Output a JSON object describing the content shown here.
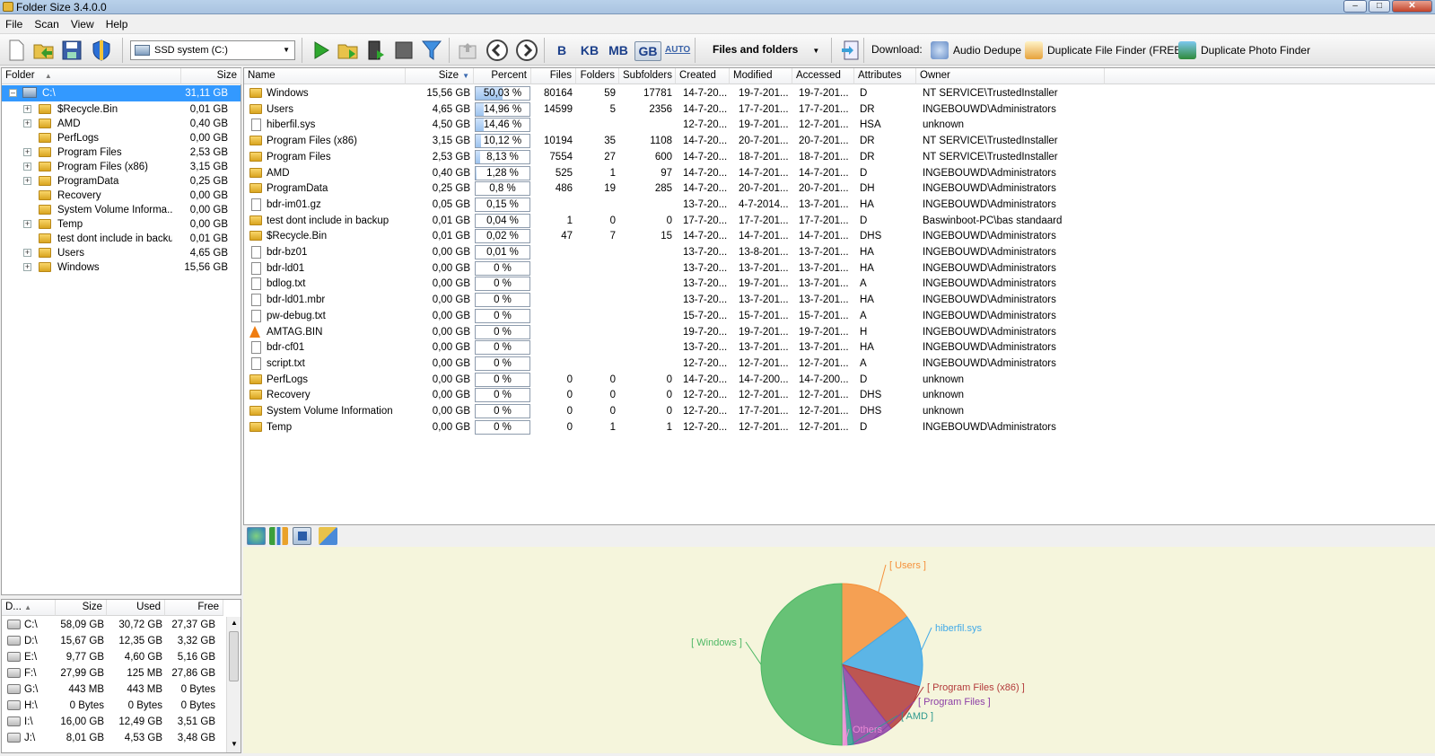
{
  "window": {
    "title": "Folder Size 3.4.0.0"
  },
  "menu": [
    "File",
    "Scan",
    "View",
    "Help"
  ],
  "toolbar": {
    "drive_select": "SSD system (C:)",
    "units": [
      "B",
      "KB",
      "MB",
      "GB",
      "AUTO"
    ],
    "active_unit": "GB",
    "view_mode": "Files and folders",
    "download_label": "Download:",
    "downloads": [
      "Audio Dedupe",
      "Duplicate File Finder (FREE)",
      "Duplicate Photo Finder"
    ]
  },
  "tree": {
    "headers": {
      "folder": "Folder",
      "size": "Size"
    },
    "root": {
      "name": "C:\\",
      "size": "31,11 GB"
    },
    "items": [
      {
        "name": "$Recycle.Bin",
        "size": "0,01 GB",
        "expandable": true
      },
      {
        "name": "AMD",
        "size": "0,40 GB",
        "expandable": true
      },
      {
        "name": "PerfLogs",
        "size": "0,00 GB",
        "expandable": false
      },
      {
        "name": "Program Files",
        "size": "2,53 GB",
        "expandable": true
      },
      {
        "name": "Program Files (x86)",
        "size": "3,15 GB",
        "expandable": true
      },
      {
        "name": "ProgramData",
        "size": "0,25 GB",
        "expandable": true
      },
      {
        "name": "Recovery",
        "size": "0,00 GB",
        "expandable": false
      },
      {
        "name": "System Volume Informa...",
        "size": "0,00 GB",
        "expandable": false
      },
      {
        "name": "Temp",
        "size": "0,00 GB",
        "expandable": true
      },
      {
        "name": "test dont include in backup",
        "size": "0,01 GB",
        "expandable": false
      },
      {
        "name": "Users",
        "size": "4,65 GB",
        "expandable": true
      },
      {
        "name": "Windows",
        "size": "15,56 GB",
        "expandable": true
      }
    ]
  },
  "drives": {
    "headers": {
      "drive": "D...",
      "size": "Size",
      "used": "Used",
      "free": "Free"
    },
    "rows": [
      {
        "drive": "C:\\",
        "size": "58,09 GB",
        "used": "30,72 GB",
        "free": "27,37 GB"
      },
      {
        "drive": "D:\\",
        "size": "15,67 GB",
        "used": "12,35 GB",
        "free": "3,32 GB"
      },
      {
        "drive": "E:\\",
        "size": "9,77 GB",
        "used": "4,60 GB",
        "free": "5,16 GB"
      },
      {
        "drive": "F:\\",
        "size": "27,99 GB",
        "used": "125 MB",
        "free": "27,86 GB"
      },
      {
        "drive": "G:\\",
        "size": "443 MB",
        "used": "443 MB",
        "free": "0 Bytes"
      },
      {
        "drive": "H:\\",
        "size": "0 Bytes",
        "used": "0 Bytes",
        "free": "0 Bytes"
      },
      {
        "drive": "I:\\",
        "size": "16,00 GB",
        "used": "12,49 GB",
        "free": "3,51 GB"
      },
      {
        "drive": "J:\\",
        "size": "8,01 GB",
        "used": "4,53 GB",
        "free": "3,48 GB"
      }
    ]
  },
  "list": {
    "headers": [
      "Name",
      "Size",
      "Percent",
      "Files",
      "Folders",
      "Subfolders",
      "Created",
      "Modified",
      "Accessed",
      "Attributes",
      "Owner"
    ],
    "rows": [
      {
        "icon": "folder",
        "name": "Windows",
        "size": "15,56 GB",
        "percent": "50,03 %",
        "pct": 50.03,
        "files": "80164",
        "folders": "59",
        "subfolders": "17781",
        "created": "14-7-20...",
        "modified": "19-7-201...",
        "accessed": "19-7-201...",
        "attr": "D",
        "owner": "NT SERVICE\\TrustedInstaller"
      },
      {
        "icon": "folder",
        "name": "Users",
        "size": "4,65 GB",
        "percent": "14,96 %",
        "pct": 14.96,
        "files": "14599",
        "folders": "5",
        "subfolders": "2356",
        "created": "14-7-20...",
        "modified": "17-7-201...",
        "accessed": "17-7-201...",
        "attr": "DR",
        "owner": "INGEBOUWD\\Administrators"
      },
      {
        "icon": "file",
        "name": "hiberfil.sys",
        "size": "4,50 GB",
        "percent": "14,46 %",
        "pct": 14.46,
        "files": "",
        "folders": "",
        "subfolders": "",
        "created": "12-7-20...",
        "modified": "19-7-201...",
        "accessed": "12-7-201...",
        "attr": "HSA",
        "owner": "unknown"
      },
      {
        "icon": "folder",
        "name": "Program Files (x86)",
        "size": "3,15 GB",
        "percent": "10,12 %",
        "pct": 10.12,
        "files": "10194",
        "folders": "35",
        "subfolders": "1108",
        "created": "14-7-20...",
        "modified": "20-7-201...",
        "accessed": "20-7-201...",
        "attr": "DR",
        "owner": "NT SERVICE\\TrustedInstaller"
      },
      {
        "icon": "folder",
        "name": "Program Files",
        "size": "2,53 GB",
        "percent": "8,13 %",
        "pct": 8.13,
        "files": "7554",
        "folders": "27",
        "subfolders": "600",
        "created": "14-7-20...",
        "modified": "18-7-201...",
        "accessed": "18-7-201...",
        "attr": "DR",
        "owner": "NT SERVICE\\TrustedInstaller"
      },
      {
        "icon": "folder",
        "name": "AMD",
        "size": "0,40 GB",
        "percent": "1,28 %",
        "pct": 1.28,
        "files": "525",
        "folders": "1",
        "subfolders": "97",
        "created": "14-7-20...",
        "modified": "14-7-201...",
        "accessed": "14-7-201...",
        "attr": "D",
        "owner": "INGEBOUWD\\Administrators"
      },
      {
        "icon": "folder",
        "name": "ProgramData",
        "size": "0,25 GB",
        "percent": "0,8 %",
        "pct": 0.8,
        "files": "486",
        "folders": "19",
        "subfolders": "285",
        "created": "14-7-20...",
        "modified": "20-7-201...",
        "accessed": "20-7-201...",
        "attr": "DH",
        "owner": "INGEBOUWD\\Administrators"
      },
      {
        "icon": "file",
        "name": "bdr-im01.gz",
        "size": "0,05 GB",
        "percent": "0,15 %",
        "pct": 0.15,
        "files": "",
        "folders": "",
        "subfolders": "",
        "created": "13-7-20...",
        "modified": "4-7-2014...",
        "accessed": "13-7-201...",
        "attr": "HA",
        "owner": "INGEBOUWD\\Administrators"
      },
      {
        "icon": "folder",
        "name": "test dont include in backup",
        "size": "0,01 GB",
        "percent": "0,04 %",
        "pct": 0.04,
        "files": "1",
        "folders": "0",
        "subfolders": "0",
        "created": "17-7-20...",
        "modified": "17-7-201...",
        "accessed": "17-7-201...",
        "attr": "D",
        "owner": "Baswinboot-PC\\bas standaard"
      },
      {
        "icon": "folder",
        "name": "$Recycle.Bin",
        "size": "0,01 GB",
        "percent": "0,02 %",
        "pct": 0.02,
        "files": "47",
        "folders": "7",
        "subfolders": "15",
        "created": "14-7-20...",
        "modified": "14-7-201...",
        "accessed": "14-7-201...",
        "attr": "DHS",
        "owner": "INGEBOUWD\\Administrators"
      },
      {
        "icon": "file",
        "name": "bdr-bz01",
        "size": "0,00 GB",
        "percent": "0,01 %",
        "pct": 0.01,
        "files": "",
        "folders": "",
        "subfolders": "",
        "created": "13-7-20...",
        "modified": "13-8-201...",
        "accessed": "13-7-201...",
        "attr": "HA",
        "owner": "INGEBOUWD\\Administrators"
      },
      {
        "icon": "file",
        "name": "bdr-ld01",
        "size": "0,00 GB",
        "percent": "0 %",
        "pct": 0,
        "files": "",
        "folders": "",
        "subfolders": "",
        "created": "13-7-20...",
        "modified": "13-7-201...",
        "accessed": "13-7-201...",
        "attr": "HA",
        "owner": "INGEBOUWD\\Administrators"
      },
      {
        "icon": "file",
        "name": "bdlog.txt",
        "size": "0,00 GB",
        "percent": "0 %",
        "pct": 0,
        "files": "",
        "folders": "",
        "subfolders": "",
        "created": "13-7-20...",
        "modified": "19-7-201...",
        "accessed": "13-7-201...",
        "attr": "A",
        "owner": "INGEBOUWD\\Administrators"
      },
      {
        "icon": "file",
        "name": "bdr-ld01.mbr",
        "size": "0,00 GB",
        "percent": "0 %",
        "pct": 0,
        "files": "",
        "folders": "",
        "subfolders": "",
        "created": "13-7-20...",
        "modified": "13-7-201...",
        "accessed": "13-7-201...",
        "attr": "HA",
        "owner": "INGEBOUWD\\Administrators"
      },
      {
        "icon": "file",
        "name": "pw-debug.txt",
        "size": "0,00 GB",
        "percent": "0 %",
        "pct": 0,
        "files": "",
        "folders": "",
        "subfolders": "",
        "created": "15-7-20...",
        "modified": "15-7-201...",
        "accessed": "15-7-201...",
        "attr": "A",
        "owner": "INGEBOUWD\\Administrators"
      },
      {
        "icon": "vlc",
        "name": "AMTAG.BIN",
        "size": "0,00 GB",
        "percent": "0 %",
        "pct": 0,
        "files": "",
        "folders": "",
        "subfolders": "",
        "created": "19-7-20...",
        "modified": "19-7-201...",
        "accessed": "19-7-201...",
        "attr": "H",
        "owner": "INGEBOUWD\\Administrators"
      },
      {
        "icon": "file",
        "name": "bdr-cf01",
        "size": "0,00 GB",
        "percent": "0 %",
        "pct": 0,
        "files": "",
        "folders": "",
        "subfolders": "",
        "created": "13-7-20...",
        "modified": "13-7-201...",
        "accessed": "13-7-201...",
        "attr": "HA",
        "owner": "INGEBOUWD\\Administrators"
      },
      {
        "icon": "file",
        "name": "script.txt",
        "size": "0,00 GB",
        "percent": "0 %",
        "pct": 0,
        "files": "",
        "folders": "",
        "subfolders": "",
        "created": "12-7-20...",
        "modified": "12-7-201...",
        "accessed": "12-7-201...",
        "attr": "A",
        "owner": "INGEBOUWD\\Administrators"
      },
      {
        "icon": "folder",
        "name": "PerfLogs",
        "size": "0,00 GB",
        "percent": "0 %",
        "pct": 0,
        "files": "0",
        "folders": "0",
        "subfolders": "0",
        "created": "14-7-20...",
        "modified": "14-7-200...",
        "accessed": "14-7-200...",
        "attr": "D",
        "owner": "unknown"
      },
      {
        "icon": "folder",
        "name": "Recovery",
        "size": "0,00 GB",
        "percent": "0 %",
        "pct": 0,
        "files": "0",
        "folders": "0",
        "subfolders": "0",
        "created": "12-7-20...",
        "modified": "12-7-201...",
        "accessed": "12-7-201...",
        "attr": "DHS",
        "owner": "unknown"
      },
      {
        "icon": "folder",
        "name": "System Volume Information",
        "size": "0,00 GB",
        "percent": "0 %",
        "pct": 0,
        "files": "0",
        "folders": "0",
        "subfolders": "0",
        "created": "12-7-20...",
        "modified": "17-7-201...",
        "accessed": "12-7-201...",
        "attr": "DHS",
        "owner": "unknown"
      },
      {
        "icon": "folder",
        "name": "Temp",
        "size": "0,00 GB",
        "percent": "0 %",
        "pct": 0,
        "files": "0",
        "folders": "1",
        "subfolders": "1",
        "created": "12-7-20...",
        "modified": "12-7-201...",
        "accessed": "12-7-201...",
        "attr": "D",
        "owner": "INGEBOUWD\\Administrators"
      }
    ]
  },
  "chart_data": {
    "type": "pie",
    "title": "",
    "slices": [
      {
        "label": "[ Users ]",
        "value": 14.96,
        "color": "#f5913b"
      },
      {
        "label": "hiberfil.sys",
        "value": 14.46,
        "color": "#41a9e8"
      },
      {
        "label": "[ Program Files (x86) ]",
        "value": 10.12,
        "color": "#b33a3a"
      },
      {
        "label": "[ Program Files ]",
        "value": 8.13,
        "color": "#8c3fa6"
      },
      {
        "label": "[ AMD ]",
        "value": 1.28,
        "color": "#2f9a8f"
      },
      {
        "label": "Others",
        "value": 1.02,
        "color": "#e98ad6"
      },
      {
        "label": "[ Windows ]",
        "value": 50.03,
        "color": "#4db864"
      }
    ]
  }
}
